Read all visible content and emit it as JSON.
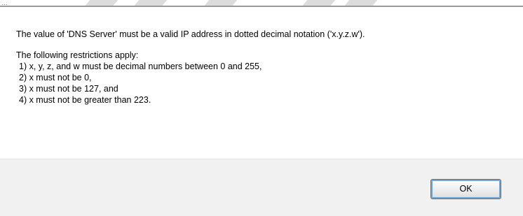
{
  "dialog": {
    "title_fragment": "...",
    "message": "The value of 'DNS Server' must be a valid IP address in dotted decimal notation ('x.y.z.w').",
    "restrictions_heading": "The following restrictions apply:",
    "restrictions": [
      "1) x, y, z, and w must be decimal numbers between 0 and 255,",
      "2) x must not be 0,",
      "3) x must not be 127, and",
      "4) x must not be greater than 223."
    ],
    "ok_label": "OK"
  },
  "colors": {
    "background": "#ffffff",
    "footer": "#f1f1f1",
    "focus_ring": "#6ea8d8"
  }
}
